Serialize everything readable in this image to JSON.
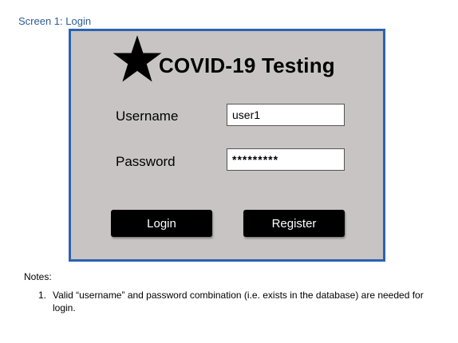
{
  "caption": "Screen 1: Login",
  "login": {
    "title": "COVID-19 Testing",
    "username_label": "Username",
    "username_value": "user1",
    "password_label": "Password",
    "password_value": "*********",
    "login_button": "Login",
    "register_button": "Register"
  },
  "notes": {
    "heading": "Notes:",
    "items": [
      {
        "number": "1.",
        "text": "Valid “username” and password combination (i.e. exists in the database) are needed for login."
      }
    ]
  },
  "colors": {
    "caption": "#2e5a94",
    "frame_border": "#2b63b0",
    "frame_background": "#c8c4c3",
    "button": "#000000"
  },
  "icons": {
    "logo": "star-icon"
  }
}
